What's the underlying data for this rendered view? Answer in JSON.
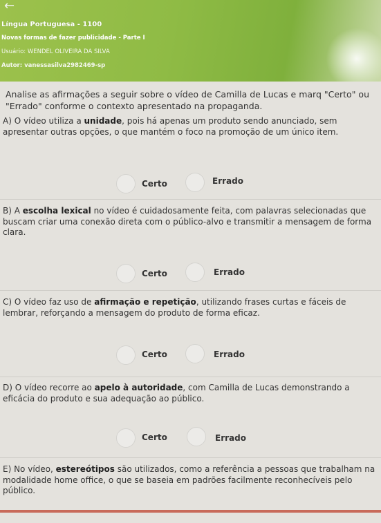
{
  "header": {
    "back_arrow": "←",
    "title": "Língua Portuguesa - 1100",
    "subtitle": "Novas formas de fazer publicidade - Parte I",
    "user": "Usuário: WENDEL OLIVEIRA DA SILVA",
    "author": "Autor: vanessasilva2982469-sp",
    "color": "#8fbb45"
  },
  "intro": "Analise as afirmações a seguir sobre o vídeo de Camilla de Lucas e marq \"Certo\" ou \"Errado\" conforme o contexto apresentado na propaganda.",
  "questions": [
    {
      "pre": "A) O vídeo utiliza a ",
      "bold": "unidade",
      "post": ", pois há apenas um produto sendo anunciado, sem apresentar outras opções, o que mantém o foco na promoção de um único item.",
      "certo": "Certo",
      "errado": "Errado"
    },
    {
      "pre": "B) A ",
      "bold": "escolha lexical",
      "post": " no vídeo é cuidadosamente feita, com palavras selecionadas que buscam criar uma conexão direta com o público-alvo e transmitir a mensagem de forma clara.",
      "certo": "Certo",
      "errado": "Errado"
    },
    {
      "pre": "C) O vídeo faz uso de ",
      "bold": "afirmação e repetição",
      "post": ", utilizando frases curtas e fáceis de lembrar, reforçando a mensagem do produto de forma eficaz.",
      "certo": "Certo",
      "errado": "Errado"
    },
    {
      "pre": "D) O vídeo recorre ao ",
      "bold": "apelo à autoridade",
      "post": ", com Camilla de Lucas demonstrando a eficácia do produto e sua adequação ao público.",
      "certo": "Certo",
      "errado": "Errado"
    },
    {
      "pre": "E) No vídeo, ",
      "bold": "estereótipos",
      "post": " são utilizados, como a referência a pessoas que trabalham na modalidade home office, o que se baseia em padrões facilmente reconhecíveis pelo público."
    }
  ]
}
